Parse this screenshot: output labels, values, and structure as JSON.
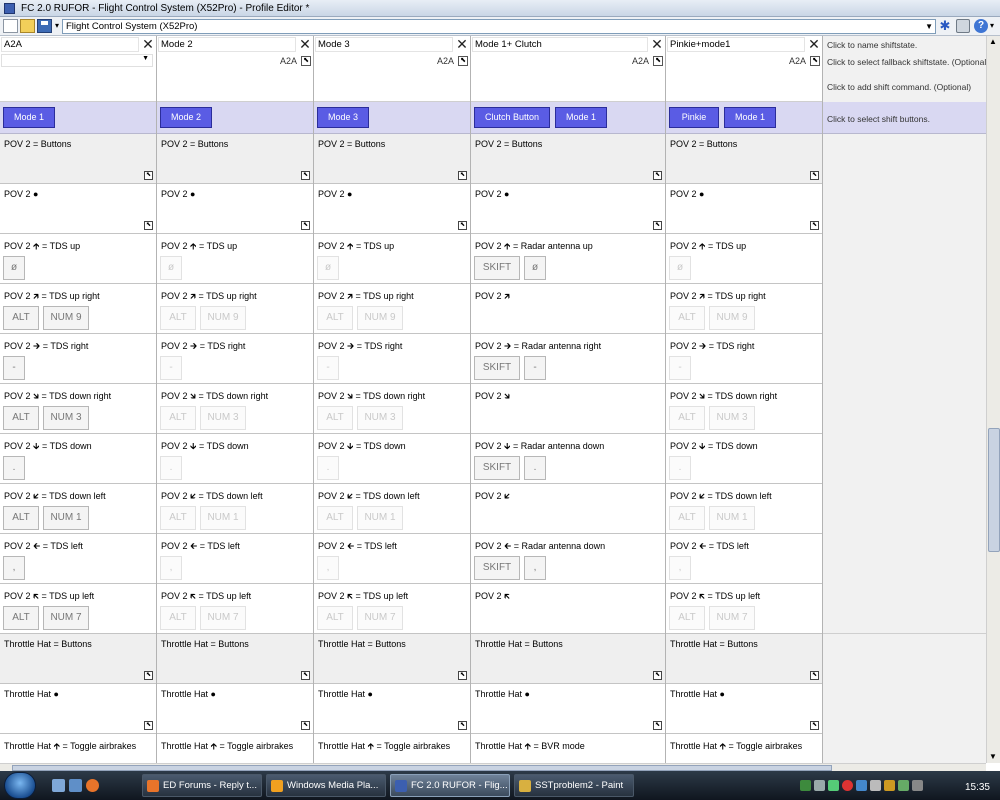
{
  "window": {
    "title": "FC 2.0 RUFOR - Flight Control System (X52Pro) - Profile Editor *"
  },
  "toolbar": {
    "profile": "Flight Control System (X52Pro)",
    "icons": [
      "new-file-icon",
      "open-folder-icon",
      "save-icon",
      "dropdown-icon",
      "star-icon",
      "print-icon",
      "help-icon"
    ]
  },
  "columns": [
    {
      "name": "A2A",
      "fallback": "",
      "shift_buttons": [
        "Mode 1"
      ],
      "cells": [
        {
          "text": "POV 2 = Buttons",
          "type": "group"
        },
        {
          "text": "POV 2 ●"
        },
        {
          "text": "POV 2 🡱 = TDS up",
          "keys": [
            "ø"
          ]
        },
        {
          "text": "POV 2 🡵 = TDS up right",
          "keys": [
            "ALT",
            "NUM 9"
          ]
        },
        {
          "text": "POV 2 🡲 = TDS right",
          "keys": [
            "-"
          ]
        },
        {
          "text": "POV 2 🡶 = TDS down right",
          "keys": [
            "ALT",
            "NUM 3"
          ]
        },
        {
          "text": "POV 2 🡳 = TDS down",
          "keys": [
            "."
          ]
        },
        {
          "text": "POV 2 🡷 = TDS down left",
          "keys": [
            "ALT",
            "NUM 1"
          ]
        },
        {
          "text": "POV 2 🡰 = TDS left",
          "keys": [
            ","
          ]
        },
        {
          "text": "POV 2 🡴 = TDS up left",
          "keys": [
            "ALT",
            "NUM 7"
          ]
        },
        {
          "text": "Throttle Hat = Buttons",
          "type": "group"
        },
        {
          "text": "Throttle Hat ●"
        },
        {
          "text": "Throttle Hat 🡱 = Toggle airbrakes"
        }
      ]
    },
    {
      "name": "Mode 2",
      "fallback": "A2A",
      "shift_buttons": [
        "Mode 2"
      ],
      "cells": [
        {
          "text": "POV 2 = Buttons",
          "type": "group"
        },
        {
          "text": "POV 2 ●"
        },
        {
          "text": "POV 2 🡱 = TDS up",
          "keys": [
            "ø"
          ],
          "faded": true
        },
        {
          "text": "POV 2 🡵 = TDS up right",
          "keys": [
            "ALT",
            "NUM 9"
          ],
          "faded": true
        },
        {
          "text": "POV 2 🡲 = TDS right",
          "keys": [
            "-"
          ],
          "faded": true
        },
        {
          "text": "POV 2 🡶 = TDS down right",
          "keys": [
            "ALT",
            "NUM 3"
          ],
          "faded": true
        },
        {
          "text": "POV 2 🡳 = TDS down",
          "keys": [
            "."
          ],
          "faded": true
        },
        {
          "text": "POV 2 🡷 = TDS down left",
          "keys": [
            "ALT",
            "NUM 1"
          ],
          "faded": true
        },
        {
          "text": "POV 2 🡰 = TDS left",
          "keys": [
            ","
          ],
          "faded": true
        },
        {
          "text": "POV 2 🡴 = TDS up left",
          "keys": [
            "ALT",
            "NUM 7"
          ],
          "faded": true
        },
        {
          "text": "Throttle Hat = Buttons",
          "type": "group"
        },
        {
          "text": "Throttle Hat ●"
        },
        {
          "text": "Throttle Hat 🡱 = Toggle airbrakes"
        }
      ]
    },
    {
      "name": "Mode 3",
      "fallback": "A2A",
      "shift_buttons": [
        "Mode 3"
      ],
      "cells": [
        {
          "text": "POV 2 = Buttons",
          "type": "group"
        },
        {
          "text": "POV 2 ●"
        },
        {
          "text": "POV 2 🡱 = TDS up",
          "keys": [
            "ø"
          ],
          "faded": true
        },
        {
          "text": "POV 2 🡵 = TDS up right",
          "keys": [
            "ALT",
            "NUM 9"
          ],
          "faded": true
        },
        {
          "text": "POV 2 🡲 = TDS right",
          "keys": [
            "-"
          ],
          "faded": true
        },
        {
          "text": "POV 2 🡶 = TDS down right",
          "keys": [
            "ALT",
            "NUM 3"
          ],
          "faded": true
        },
        {
          "text": "POV 2 🡳 = TDS down",
          "keys": [
            "."
          ],
          "faded": true
        },
        {
          "text": "POV 2 🡷 = TDS down left",
          "keys": [
            "ALT",
            "NUM 1"
          ],
          "faded": true
        },
        {
          "text": "POV 2 🡰 = TDS left",
          "keys": [
            ","
          ],
          "faded": true
        },
        {
          "text": "POV 2 🡴 = TDS up left",
          "keys": [
            "ALT",
            "NUM 7"
          ],
          "faded": true
        },
        {
          "text": "Throttle Hat = Buttons",
          "type": "group"
        },
        {
          "text": "Throttle Hat ●"
        },
        {
          "text": "Throttle Hat 🡱 = Toggle airbrakes"
        }
      ]
    },
    {
      "name": "Mode 1+ Clutch",
      "fallback": "A2A",
      "shift_buttons": [
        "Clutch Button",
        "Mode 1"
      ],
      "cells": [
        {
          "text": "POV 2 = Buttons",
          "type": "group"
        },
        {
          "text": "POV 2 ●"
        },
        {
          "text": "POV 2 🡱 = Radar antenna up",
          "keys": [
            "SKIFT",
            "ø"
          ]
        },
        {
          "text": "POV 2 🡵"
        },
        {
          "text": "POV 2 🡲 = Radar antenna right",
          "keys": [
            "SKIFT",
            "-"
          ]
        },
        {
          "text": "POV 2 🡶"
        },
        {
          "text": "POV 2 🡳 = Radar antenna down",
          "keys": [
            "SKIFT",
            "."
          ]
        },
        {
          "text": "POV 2 🡷"
        },
        {
          "text": "POV 2 🡰 = Radar antenna down",
          "keys": [
            "SKIFT",
            ","
          ]
        },
        {
          "text": "POV 2 🡴"
        },
        {
          "text": "Throttle Hat = Buttons",
          "type": "group"
        },
        {
          "text": "Throttle Hat ●"
        },
        {
          "text": "Throttle Hat 🡱 = BVR mode"
        }
      ]
    },
    {
      "name": "Pinkie+mode1",
      "fallback": "A2A",
      "shift_buttons": [
        "Pinkie",
        "Mode 1"
      ],
      "cells": [
        {
          "text": "POV 2 = Buttons",
          "type": "group"
        },
        {
          "text": "POV 2 ●"
        },
        {
          "text": "POV 2 🡱 = TDS up",
          "keys": [
            "ø"
          ],
          "faded": true
        },
        {
          "text": "POV 2 🡵 = TDS up right",
          "keys": [
            "ALT",
            "NUM 9"
          ],
          "faded": true
        },
        {
          "text": "POV 2 🡲 = TDS right",
          "keys": [
            "-"
          ],
          "faded": true
        },
        {
          "text": "POV 2 🡶 = TDS down right",
          "keys": [
            "ALT",
            "NUM 3"
          ],
          "faded": true
        },
        {
          "text": "POV 2 🡳 = TDS down",
          "keys": [
            "."
          ],
          "faded": true
        },
        {
          "text": "POV 2 🡷 = TDS down left",
          "keys": [
            "ALT",
            "NUM 1"
          ],
          "faded": true
        },
        {
          "text": "POV 2 🡰 = TDS left",
          "keys": [
            ","
          ],
          "faded": true
        },
        {
          "text": "POV 2 🡴 = TDS up left",
          "keys": [
            "ALT",
            "NUM 7"
          ],
          "faded": true
        },
        {
          "text": "Throttle Hat = Buttons",
          "type": "group"
        },
        {
          "text": "Throttle Hat ●"
        },
        {
          "text": "Throttle Hat 🡱 = Toggle airbrakes"
        }
      ]
    }
  ],
  "info": {
    "name_hint": "Click to name shiftstate.",
    "fallback_hint": "Click to select fallback shiftstate. (Optional)",
    "command_hint": "Click to add shift command. (Optional)",
    "shift_hint": "Click to select shift buttons."
  },
  "taskbar": {
    "tasks": [
      {
        "label": "ED Forums - Reply t...",
        "icon_color": "#e8742a"
      },
      {
        "label": "Windows Media Pla...",
        "icon_color": "#f0a020"
      },
      {
        "label": "FC 2.0 RUFOR - Flig...",
        "icon_color": "#3c5fb0",
        "active": true
      },
      {
        "label": "SSTproblem2 - Paint",
        "icon_color": "#d8b040"
      }
    ],
    "clock": "15:35"
  }
}
